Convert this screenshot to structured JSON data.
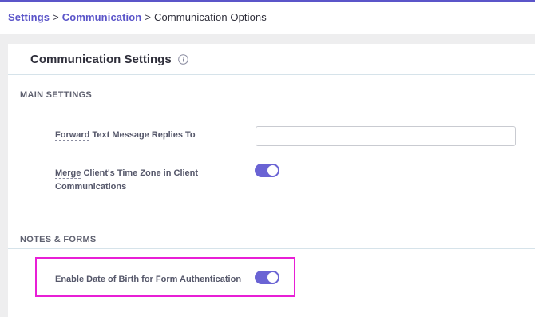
{
  "breadcrumb": {
    "settings": "Settings",
    "communication": "Communication",
    "current": "Communication Options",
    "separator": ">"
  },
  "card": {
    "title": "Communication Settings",
    "info_icon": "info-circle-icon"
  },
  "sections": {
    "main": {
      "label": "MAIN SETTINGS",
      "forward_label_prefix": "Forward",
      "forward_label_rest": " Text Message Replies To",
      "forward_value": "",
      "merge_label_prefix": "Merge",
      "merge_label_rest": " Client's Time Zone in Client Communications",
      "merge_enabled": true
    },
    "notes": {
      "label": "NOTES & FORMS",
      "dob_label": "Enable Date of Birth for Form Authentication",
      "dob_enabled": true
    }
  },
  "colors": {
    "accent": "#5b55c9",
    "toggle_on": "#6a63d4",
    "highlight": "#e81fd6"
  }
}
